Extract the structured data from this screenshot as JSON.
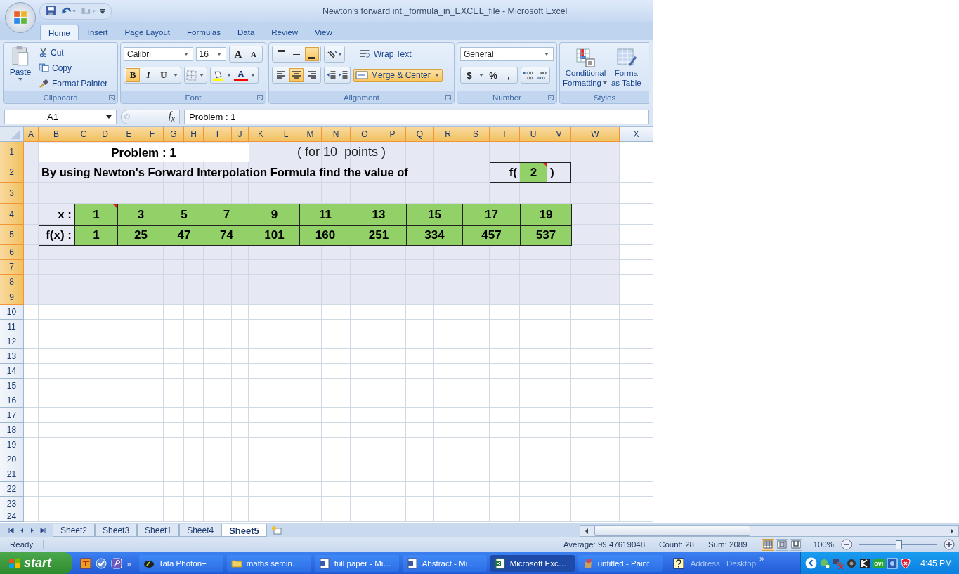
{
  "window": {
    "title": "Newton's forward int._formula_in_EXCEL_file - Microsoft Excel"
  },
  "ribbon_tabs": [
    {
      "label": "Home",
      "selected": true
    },
    {
      "label": "Insert",
      "selected": false
    },
    {
      "label": "Page Layout",
      "selected": false
    },
    {
      "label": "Formulas",
      "selected": false
    },
    {
      "label": "Data",
      "selected": false
    },
    {
      "label": "Review",
      "selected": false
    },
    {
      "label": "View",
      "selected": false
    }
  ],
  "clipboard": {
    "label": "Clipboard",
    "paste": "Paste",
    "cut": "Cut",
    "copy": "Copy",
    "format_painter": "Format Painter"
  },
  "font": {
    "label": "Font",
    "name": "Calibri",
    "size": "16",
    "grow": "A",
    "shrink": "A",
    "styles": [
      {
        "text": "B",
        "kind": "bold",
        "on": true
      },
      {
        "text": "I",
        "kind": "italic",
        "on": false
      },
      {
        "text": "U",
        "kind": "underline",
        "on": false
      }
    ],
    "font_color": "A"
  },
  "alignment": {
    "label": "Alignment",
    "vertical": [
      {
        "kind": "top",
        "on": false
      },
      {
        "kind": "middle",
        "on": false
      },
      {
        "kind": "bottom",
        "on": true
      }
    ],
    "horizontal": [
      {
        "kind": "left",
        "on": false
      },
      {
        "kind": "center",
        "on": true
      },
      {
        "kind": "right",
        "on": false
      }
    ],
    "wrap_text": "Wrap Text",
    "merge": {
      "label": "Merge & Center",
      "on": true
    }
  },
  "number": {
    "label": "Number",
    "format": "General",
    "currency": "$",
    "percent": "%",
    "comma": ","
  },
  "styles": {
    "label": "Styles",
    "conditional": [
      "Conditional",
      "Formatting"
    ],
    "format_table": [
      "Forma",
      "as Table"
    ]
  },
  "formula_bar": {
    "name_box": "A1",
    "function_button": "f$_{x}$",
    "formula": "Problem : 1"
  },
  "column_headers": [
    {
      "label": "A",
      "selected": true
    },
    {
      "label": "B",
      "selected": true
    },
    {
      "label": "C",
      "selected": true
    },
    {
      "label": "D",
      "selected": true
    },
    {
      "label": "E",
      "selected": true
    },
    {
      "label": "F",
      "selected": true
    },
    {
      "label": "G",
      "selected": true
    },
    {
      "label": "H",
      "selected": true
    },
    {
      "label": "I",
      "selected": true
    },
    {
      "label": "J",
      "selected": true
    },
    {
      "label": "K",
      "selected": true
    },
    {
      "label": "L",
      "selected": true
    },
    {
      "label": "M",
      "selected": true
    },
    {
      "label": "N",
      "selected": true
    },
    {
      "label": "O",
      "selected": true
    },
    {
      "label": "P",
      "selected": true
    },
    {
      "label": "Q",
      "selected": true
    },
    {
      "label": "R",
      "selected": true
    },
    {
      "label": "S",
      "selected": true
    },
    {
      "label": "T",
      "selected": true
    },
    {
      "label": "U",
      "selected": true
    },
    {
      "label": "V",
      "selected": true
    },
    {
      "label": "W",
      "selected": true
    },
    {
      "label": "X",
      "selected": false
    }
  ],
  "row_headers": [
    {
      "label": "1",
      "selected": true
    },
    {
      "label": "2",
      "selected": true
    },
    {
      "label": "3",
      "selected": true
    },
    {
      "label": "4",
      "selected": true
    },
    {
      "label": "5",
      "selected": true
    },
    {
      "label": "6",
      "selected": true
    },
    {
      "label": "7",
      "selected": true
    },
    {
      "label": "8",
      "selected": true
    },
    {
      "label": "9",
      "selected": true
    },
    {
      "label": "10",
      "selected": false
    },
    {
      "label": "11",
      "selected": false
    },
    {
      "label": "12",
      "selected": false
    },
    {
      "label": "13",
      "selected": false
    },
    {
      "label": "14",
      "selected": false
    },
    {
      "label": "15",
      "selected": false
    },
    {
      "label": "16",
      "selected": false
    },
    {
      "label": "17",
      "selected": false
    },
    {
      "label": "18",
      "selected": false
    },
    {
      "label": "19",
      "selected": false
    },
    {
      "label": "20",
      "selected": false
    },
    {
      "label": "21",
      "selected": false
    },
    {
      "label": "22",
      "selected": false
    },
    {
      "label": "23",
      "selected": false
    },
    {
      "label": "24",
      "selected": false
    }
  ],
  "sheet": {
    "title": "Problem : 1",
    "note": "( for 10  points )",
    "instruction": "By using Newton's Forward Interpolation Formula find the value of",
    "evaluate": {
      "prefix": "f(",
      "value": "2",
      "suffix": ")",
      "has_comment": true
    },
    "x_label": "x :",
    "x_values": [
      {
        "text": "1",
        "has_comment": true
      },
      {
        "text": "3",
        "has_comment": false
      },
      {
        "text": "5",
        "has_comment": false
      },
      {
        "text": "7",
        "has_comment": false
      },
      {
        "text": "9",
        "has_comment": false
      },
      {
        "text": "11",
        "has_comment": false
      },
      {
        "text": "13",
        "has_comment": false
      },
      {
        "text": "15",
        "has_comment": false
      },
      {
        "text": "17",
        "has_comment": false
      },
      {
        "text": "19",
        "has_comment": false
      }
    ],
    "fx_label": "f(x) :",
    "fx_values": [
      "1",
      "25",
      "47",
      "74",
      "101",
      "160",
      "251",
      "334",
      "457",
      "537"
    ]
  },
  "sheet_tabs": [
    {
      "label": "Sheet2",
      "selected": false
    },
    {
      "label": "Sheet3",
      "selected": false
    },
    {
      "label": "Sheet1",
      "selected": false
    },
    {
      "label": "Sheet4",
      "selected": false
    },
    {
      "label": "Sheet5",
      "selected": true
    }
  ],
  "status_bar": {
    "mode": "Ready",
    "average": "Average: 99.47619048",
    "count": "Count: 28",
    "sum": "Sum: 2089",
    "zoom": "100%",
    "zoom_slider": {
      "level": 0.52
    },
    "views": [
      {
        "kind": "normal",
        "selected": true
      },
      {
        "kind": "page_layout",
        "selected": false
      },
      {
        "kind": "page_break",
        "selected": false
      }
    ]
  },
  "taskbar": {
    "start": "start",
    "overflow": "»",
    "tasks": [
      {
        "label": "Tata Photon+",
        "kind": "modem",
        "selected": false
      },
      {
        "label": "maths semin…",
        "kind": "folder",
        "selected": false
      },
      {
        "label": "full paper - Mi…",
        "kind": "word",
        "selected": false
      },
      {
        "label": "Abstract - Mi…",
        "kind": "word",
        "selected": false
      },
      {
        "label": "Microsoft Exc…",
        "kind": "excel",
        "selected": true
      },
      {
        "label": "untitled - Paint",
        "kind": "paint",
        "selected": false
      }
    ],
    "toolbars": [
      "Address",
      "Desktop"
    ],
    "toolbar_overflow": "»",
    "tray_badge": "ovi",
    "clock": "4:45 PM"
  }
}
